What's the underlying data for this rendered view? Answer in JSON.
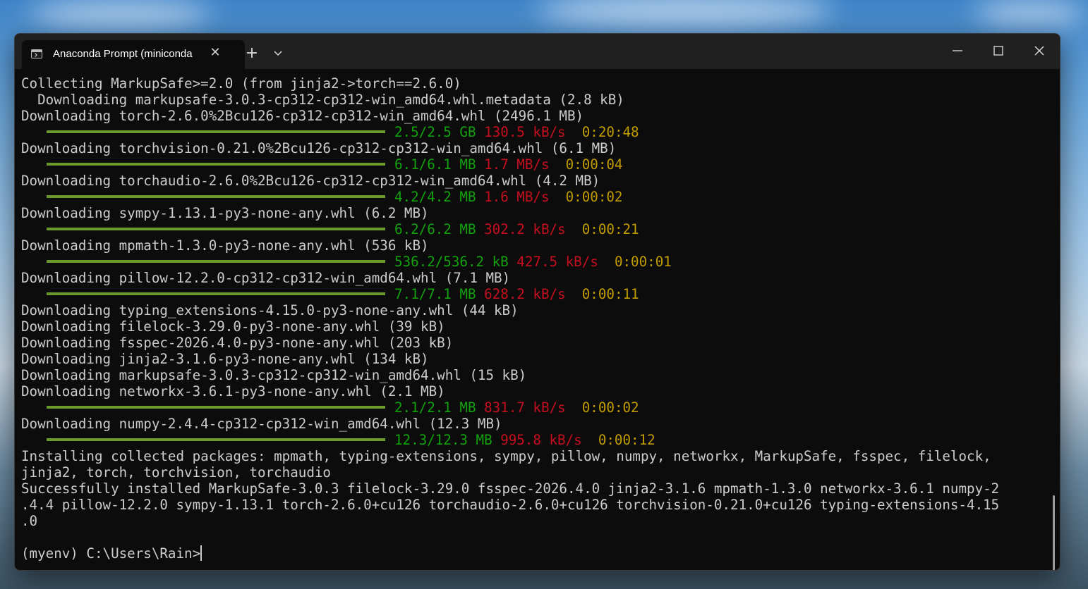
{
  "window": {
    "tab_title": "Anaconda Prompt (miniconda",
    "tab_close": "✕",
    "new_tab": "+",
    "colors": {
      "green": "#13a10e",
      "red": "#c50f1f",
      "yellow": "#c19c00",
      "text": "#cccccc",
      "background": "#0c0c0c"
    }
  },
  "terminal": {
    "lines": [
      {
        "type": "text",
        "text": "Collecting MarkupSafe>=2.0 (from jinja2->torch==2.6.0)"
      },
      {
        "type": "text",
        "text": "  Downloading markupsafe-3.0.3-cp312-cp312-win_amd64.whl.metadata (2.8 kB)"
      },
      {
        "type": "text",
        "text": "Downloading torch-2.6.0%2Bcu126-cp312-cp312-win_amd64.whl (2496.1 MB)"
      },
      {
        "type": "progress",
        "progress": 1.0,
        "size": "2.5/2.5 GB",
        "speed": "130.5 kB/s",
        "eta": "0:20:48"
      },
      {
        "type": "text",
        "text": "Downloading torchvision-0.21.0%2Bcu126-cp312-cp312-win_amd64.whl (6.1 MB)"
      },
      {
        "type": "progress",
        "progress": 1.0,
        "size": "6.1/6.1 MB",
        "speed": "1.7 MB/s",
        "eta": "0:00:04"
      },
      {
        "type": "text",
        "text": "Downloading torchaudio-2.6.0%2Bcu126-cp312-cp312-win_amd64.whl (4.2 MB)"
      },
      {
        "type": "progress",
        "progress": 1.0,
        "size": "4.2/4.2 MB",
        "speed": "1.6 MB/s",
        "eta": "0:00:02"
      },
      {
        "type": "text",
        "text": "Downloading sympy-1.13.1-py3-none-any.whl (6.2 MB)"
      },
      {
        "type": "progress",
        "progress": 1.0,
        "size": "6.2/6.2 MB",
        "speed": "302.2 kB/s",
        "eta": "0:00:21"
      },
      {
        "type": "text",
        "text": "Downloading mpmath-1.3.0-py3-none-any.whl (536 kB)"
      },
      {
        "type": "progress",
        "progress": 1.0,
        "size": "536.2/536.2 kB",
        "speed": "427.5 kB/s",
        "eta": "0:00:01"
      },
      {
        "type": "text",
        "text": "Downloading pillow-12.2.0-cp312-cp312-win_amd64.whl (7.1 MB)"
      },
      {
        "type": "progress",
        "progress": 1.0,
        "size": "7.1/7.1 MB",
        "speed": "628.2 kB/s",
        "eta": "0:00:11"
      },
      {
        "type": "text",
        "text": "Downloading typing_extensions-4.15.0-py3-none-any.whl (44 kB)"
      },
      {
        "type": "text",
        "text": "Downloading filelock-3.29.0-py3-none-any.whl (39 kB)"
      },
      {
        "type": "text",
        "text": "Downloading fsspec-2026.4.0-py3-none-any.whl (203 kB)"
      },
      {
        "type": "text",
        "text": "Downloading jinja2-3.1.6-py3-none-any.whl (134 kB)"
      },
      {
        "type": "text",
        "text": "Downloading markupsafe-3.0.3-cp312-cp312-win_amd64.whl (15 kB)"
      },
      {
        "type": "text",
        "text": "Downloading networkx-3.6.1-py3-none-any.whl (2.1 MB)"
      },
      {
        "type": "progress",
        "progress": 1.0,
        "size": "2.1/2.1 MB",
        "speed": "831.7 kB/s",
        "eta": "0:00:02"
      },
      {
        "type": "text",
        "text": "Downloading numpy-2.4.4-cp312-cp312-win_amd64.whl (12.3 MB)"
      },
      {
        "type": "progress",
        "progress": 1.0,
        "size": "12.3/12.3 MB",
        "speed": "995.8 kB/s",
        "eta": "0:00:12"
      },
      {
        "type": "text",
        "text": "Installing collected packages: mpmath, typing-extensions, sympy, pillow, numpy, networkx, MarkupSafe, fsspec, filelock,"
      },
      {
        "type": "text",
        "text": "jinja2, torch, torchvision, torchaudio"
      },
      {
        "type": "text",
        "text": "Successfully installed MarkupSafe-3.0.3 filelock-3.29.0 fsspec-2026.4.0 jinja2-3.1.6 mpmath-1.3.0 networkx-3.6.1 numpy-2"
      },
      {
        "type": "text",
        "text": ".4.4 pillow-12.2.0 sympy-1.13.1 torch-2.6.0+cu126 torchaudio-2.6.0+cu126 torchvision-0.21.0+cu126 typing-extensions-4.15"
      },
      {
        "type": "text",
        "text": ".0"
      },
      {
        "type": "text",
        "text": ""
      }
    ],
    "prompt": "(myenv) C:\\Users\\Rain>"
  }
}
